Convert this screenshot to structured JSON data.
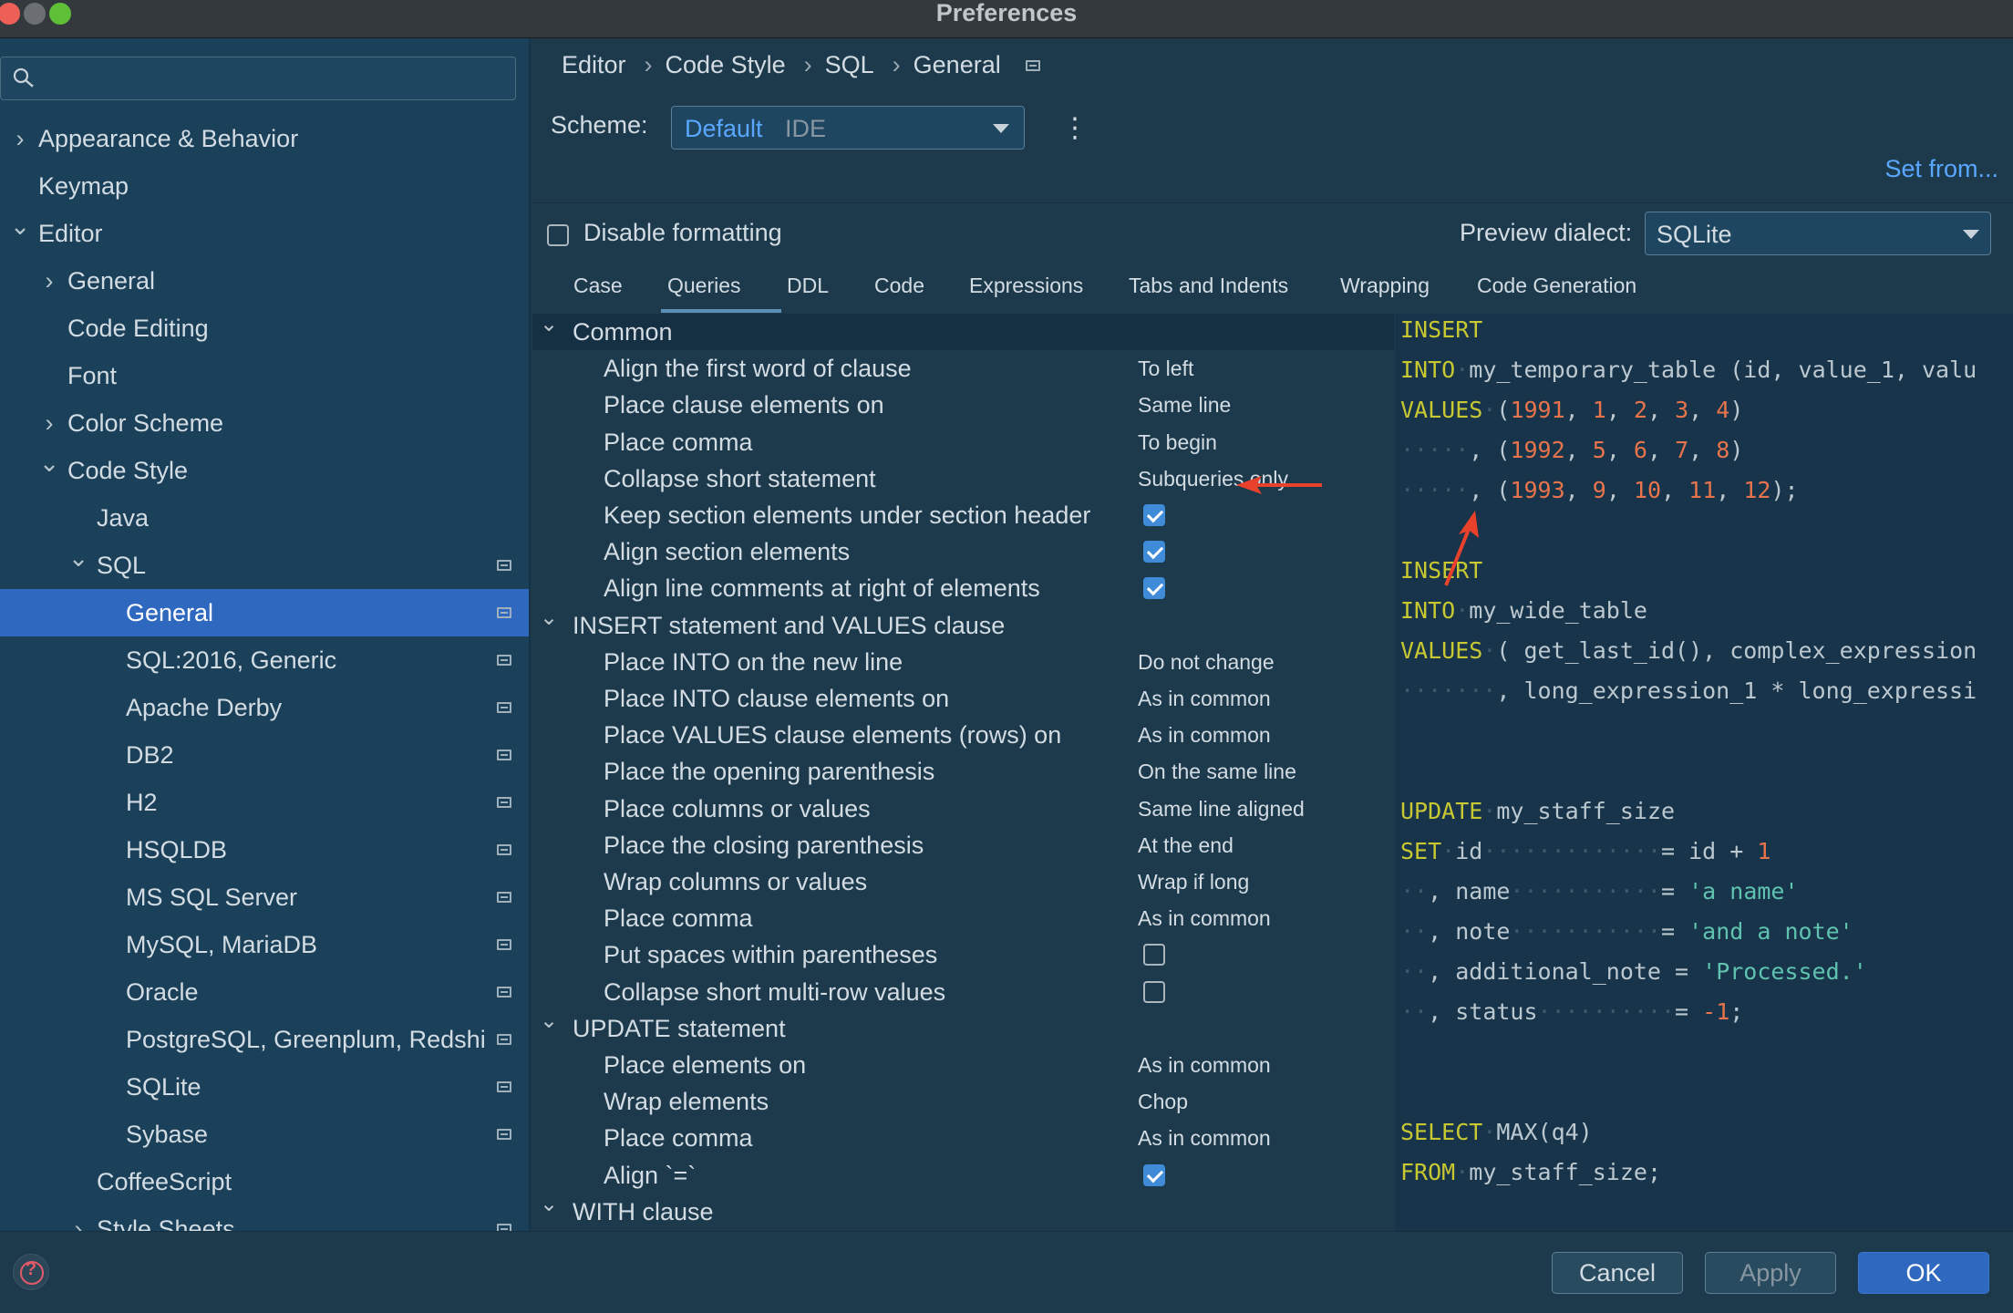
{
  "window": {
    "title": "Preferences"
  },
  "colors": {
    "accent": "#2e68bf",
    "link": "#5aa7ff",
    "keyword": "#c8c832",
    "number": "#e8744c",
    "string": "#5fc3b0",
    "annotation_arrow": "#e8412c"
  },
  "sidebar": {
    "search_placeholder": "",
    "items": [
      {
        "label": "Appearance & Behavior",
        "chevron": "›"
      },
      {
        "label": "Keymap",
        "chevron": ""
      },
      {
        "label": "Editor",
        "chevron": "⌄"
      },
      {
        "label": "General",
        "chevron": "›"
      },
      {
        "label": "Code Editing",
        "chevron": ""
      },
      {
        "label": "Font",
        "chevron": ""
      },
      {
        "label": "Color Scheme",
        "chevron": "›"
      },
      {
        "label": "Code Style",
        "chevron": "⌄"
      },
      {
        "label": "Java",
        "chevron": ""
      },
      {
        "label": "SQL",
        "chevron": "⌄"
      },
      {
        "label": "General",
        "chevron": ""
      },
      {
        "label": "SQL:2016, Generic",
        "chevron": ""
      },
      {
        "label": "Apache Derby",
        "chevron": ""
      },
      {
        "label": "DB2",
        "chevron": ""
      },
      {
        "label": "H2",
        "chevron": ""
      },
      {
        "label": "HSQLDB",
        "chevron": ""
      },
      {
        "label": "MS SQL Server",
        "chevron": ""
      },
      {
        "label": "MySQL, MariaDB",
        "chevron": ""
      },
      {
        "label": "Oracle",
        "chevron": ""
      },
      {
        "label": "PostgreSQL, Greenplum, Redshi",
        "chevron": ""
      },
      {
        "label": "SQLite",
        "chevron": ""
      },
      {
        "label": "Sybase",
        "chevron": ""
      },
      {
        "label": "CoffeeScript",
        "chevron": ""
      },
      {
        "label": "Style Sheets",
        "chevron": "›"
      }
    ]
  },
  "breadcrumb": [
    "Editor",
    "Code Style",
    "SQL",
    "General"
  ],
  "breadcrumb_sep": "›",
  "scheme": {
    "label": "Scheme:",
    "value": "Default",
    "type": "IDE"
  },
  "kebab": "⋮",
  "set_from": "Set from...",
  "disable_formatting": {
    "label": "Disable formatting",
    "checked": false
  },
  "preview_dialect": {
    "label": "Preview dialect:",
    "value": "SQLite"
  },
  "tabs": [
    "Case",
    "Queries",
    "DDL",
    "Code",
    "Expressions",
    "Tabs and Indents",
    "Wrapping",
    "Code Generation"
  ],
  "active_tab": "Queries",
  "settings": {
    "common": {
      "header": "Common",
      "rows": [
        {
          "name": "Align the first word of clause",
          "value": "To left"
        },
        {
          "name": "Place clause elements on",
          "value": "Same line"
        },
        {
          "name": "Place comma",
          "value": "To begin"
        },
        {
          "name": "Collapse short statement",
          "value": "Subqueries only"
        },
        {
          "name": "Keep section elements under section header",
          "checked": true
        },
        {
          "name": "Align section elements",
          "checked": true
        },
        {
          "name": "Align line comments at right of elements",
          "checked": true
        }
      ]
    },
    "insert": {
      "header": "INSERT statement and VALUES clause",
      "rows": [
        {
          "name": "Place INTO on the new line",
          "value": "Do not change"
        },
        {
          "name": "Place INTO clause elements on",
          "value": "As in common"
        },
        {
          "name": "Place VALUES clause elements (rows) on",
          "value": "As in common"
        },
        {
          "name": "Place the opening parenthesis",
          "value": "On the same line"
        },
        {
          "name": "Place columns or values",
          "value": "Same line aligned"
        },
        {
          "name": "Place the closing parenthesis",
          "value": "At the end"
        },
        {
          "name": "Wrap columns or values",
          "value": "Wrap if long"
        },
        {
          "name": "Place comma",
          "value": "As in common"
        },
        {
          "name": "Put spaces within parentheses",
          "checked": false
        },
        {
          "name": "Collapse short multi-row values",
          "checked": false
        }
      ]
    },
    "update": {
      "header": "UPDATE statement",
      "rows": [
        {
          "name": "Place elements on",
          "value": "As in common"
        },
        {
          "name": "Wrap elements",
          "value": "Chop"
        },
        {
          "name": "Place comma",
          "value": "As in common"
        },
        {
          "name": "Align `=`",
          "checked": true
        }
      ]
    },
    "with": {
      "header": "WITH clause"
    }
  },
  "preview_code": {
    "l1": "INSERT",
    "l2_kw": "INTO",
    "l2_rest": "my_temporary_table (id, value_1, valu",
    "l3_kw": "VALUES",
    "l3_n": [
      "1991",
      "1",
      "2",
      "3",
      "4"
    ],
    "l4_n": [
      "1992",
      "5",
      "6",
      "7",
      "8"
    ],
    "l5_n": [
      "1993",
      "9",
      "10",
      "11",
      "12"
    ],
    "l7": "INSERT",
    "l8_kw": "INTO",
    "l8_rest": "my_wide_table",
    "l9_kw": "VALUES",
    "l9_rest": "( get_last_id(), complex_expression",
    "l10_rest": ", long_expression_1 * long_expressi",
    "l13_kw": "UPDATE",
    "l13_rest": "my_staff_size",
    "l14_kw": "SET",
    "l14_col": "id",
    "l14_expr": "= id + ",
    "l14_n": "1",
    "l15_col": ", name",
    "l15_str": "'a name'",
    "l16_col": ", note",
    "l16_str": "'and a note'",
    "l17_col": ", additional_note",
    "l17_str": "'Processed.'",
    "l18_col": ", status",
    "l18_n": "-1",
    "l21_kw": "SELECT",
    "l21_rest": "MAX(q4)",
    "l22_kw": "FROM",
    "l22_rest": "my_staff_size;"
  },
  "buttons": {
    "cancel": "Cancel",
    "apply": "Apply",
    "ok": "OK"
  },
  "help_glyph": "?"
}
